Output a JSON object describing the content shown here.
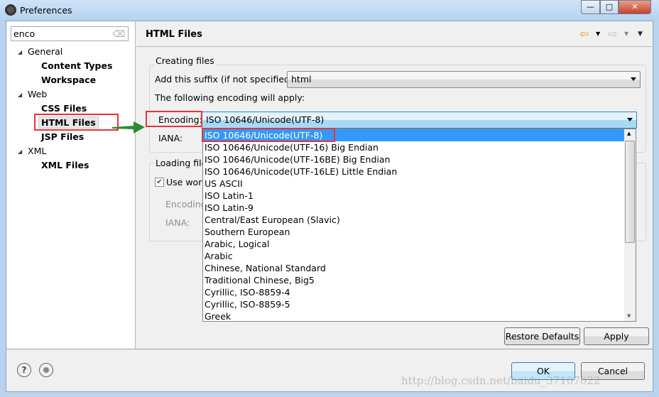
{
  "window": {
    "title": "Preferences",
    "minimize": "—",
    "maximize": "□",
    "close": "✕"
  },
  "sidebar": {
    "search_value": "enco",
    "search_clear_icon": "eraser-icon",
    "tree": [
      {
        "label": "General",
        "expanded": true,
        "children": [
          "Content Types",
          "Workspace"
        ]
      },
      {
        "label": "Web",
        "expanded": true,
        "children": [
          "CSS Files",
          "HTML Files",
          "JSP Files"
        ]
      },
      {
        "label": "XML",
        "expanded": true,
        "children": [
          "XML Files"
        ]
      }
    ],
    "expand_glyph": "◢",
    "selected": "HTML Files"
  },
  "header": {
    "title": "HTML Files",
    "back_icon": "⇦",
    "forward_icon": "⇨",
    "menu_glyph": "▼"
  },
  "creating": {
    "group_label": "Creating files",
    "suffix_label": "Add this suffix (if not specified):",
    "suffix_value": "html",
    "encoding_note": "The following encoding will apply:",
    "encoding_label": "Encoding:",
    "encoding_value": "ISO 10646/Unicode(UTF-8)",
    "iana_label": "IANA:"
  },
  "loading": {
    "group_label": "Loading file",
    "checkbox_label": "Use worl",
    "checkbox_checked": true,
    "encoding_label": "Encoding",
    "iana_label": "IANA:"
  },
  "dropdown": {
    "selected_index": 0,
    "options": [
      "ISO 10646/Unicode(UTF-8)",
      "ISO 10646/Unicode(UTF-16) Big Endian",
      "ISO 10646/Unicode(UTF-16BE) Big Endian",
      "ISO 10646/Unicode(UTF-16LE) Little Endian",
      "US ASCII",
      "ISO Latin-1",
      "ISO Latin-9",
      "Central/East European (Slavic)",
      "Southern European",
      "Arabic, Logical",
      "Arabic",
      "Chinese, National Standard",
      "Traditional Chinese, Big5",
      "Cyrillic, ISO-8859-4",
      "Cyrillic, ISO-8859-5",
      "Greek"
    ]
  },
  "buttons": {
    "restore": "Restore Defaults",
    "apply": "Apply",
    "ok": "OK",
    "cancel": "Cancel",
    "help": "?"
  },
  "watermark": "http://blog.csdn.net/baidu_37107022",
  "colors": {
    "selection": "#3399ff",
    "annotation_red": "#e8333b",
    "annotation_arrow": "#2e8b34"
  }
}
